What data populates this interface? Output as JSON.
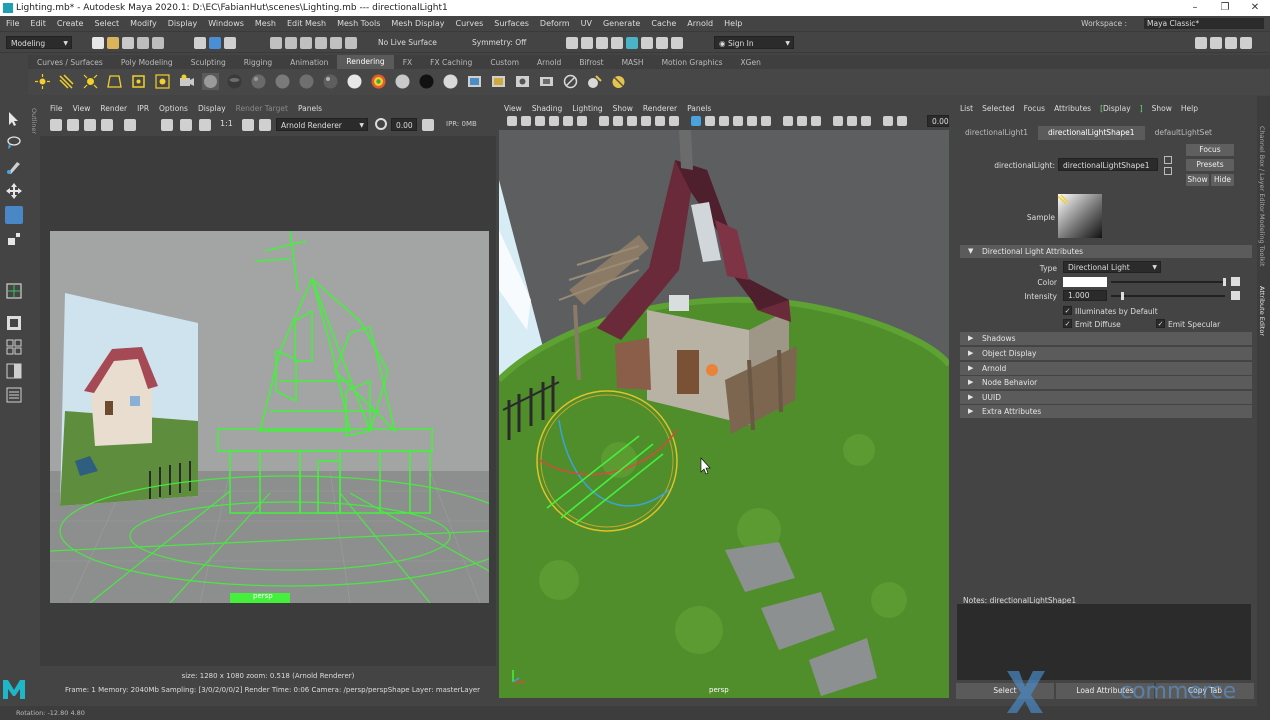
{
  "window": {
    "title": "Lighting.mb* - Autodesk Maya 2020.1: D:\\EC\\FabianHut\\scenes\\Lighting.mb   ---   directionalLight1",
    "controls": [
      "–",
      "❐",
      "✕"
    ]
  },
  "menubar": {
    "items": [
      "File",
      "Edit",
      "Create",
      "Select",
      "Modify",
      "Display",
      "Windows",
      "Mesh",
      "Edit Mesh",
      "Mesh Tools",
      "Mesh Display",
      "Curves",
      "Surfaces",
      "Deform",
      "UV",
      "Generate",
      "Cache",
      "Arnold",
      "Help"
    ],
    "workspace_label": "Workspace :",
    "workspace_value": "Maya Classic*"
  },
  "statusline": {
    "menuset": "Modeling",
    "live_surface": "No Live Surface",
    "symmetry": "Symmetry: Off",
    "sign_in": "Sign In"
  },
  "shelf": {
    "tabs": [
      "Curves / Surfaces",
      "Poly Modeling",
      "Sculpting",
      "Rigging",
      "Animation",
      "Rendering",
      "FX",
      "FX Caching",
      "Custom",
      "Arnold",
      "Bifrost",
      "MASH",
      "Motion Graphics",
      "XGen"
    ],
    "active_tab": "Rendering"
  },
  "render_view": {
    "menu": [
      "File",
      "View",
      "Render",
      "IPR",
      "Options",
      "Display",
      "Render Target",
      "Panels"
    ],
    "ratio": "1:1",
    "renderer": "Arnold Renderer",
    "exposure": "0.00",
    "ipr_mem": "IPR: 0MB",
    "camera_label": "persp",
    "status_line1": "size: 1280 x 1080  zoom: 0.518      (Arnold Renderer)",
    "status_line2": "Frame: 1      Memory: 2040Mb      Sampling: [3/0/2/0/0/2]   Render Time: 0:06      Camera: /persp/perspShape      Layer: masterLayer"
  },
  "viewport": {
    "menu": [
      "View",
      "Shading",
      "Lighting",
      "Show",
      "Renderer",
      "Panels"
    ],
    "value": "0.00",
    "camera_label": "persp"
  },
  "attribute_editor": {
    "menu": [
      "List",
      "Selected",
      "Focus",
      "Attributes",
      "Display",
      "Show",
      "Help"
    ],
    "tabs": [
      "directionalLight1",
      "directionalLightShape1",
      "defaultLightSet"
    ],
    "active_tab": "directionalLightShape1",
    "node_label": "directionalLight:",
    "node_value": "directionalLightShape1",
    "focus": "Focus",
    "presets": "Presets",
    "show": "Show",
    "hide": "Hide",
    "sample_label": "Sample",
    "section_open": "Directional Light Attributes",
    "type_label": "Type",
    "type_value": "Directional Light",
    "color_label": "Color",
    "intensity_label": "Intensity",
    "intensity_value": "1.000",
    "illuminates": "Illuminates by Default",
    "emit_diffuse": "Emit Diffuse",
    "emit_specular": "Emit Specular",
    "sections_closed": [
      "Shadows",
      "Object Display",
      "Arnold",
      "Node Behavior",
      "UUID",
      "Extra Attributes"
    ],
    "notes": "Notes:  directionalLightShape1",
    "bottom_buttons": [
      "Select",
      "Load Attributes",
      "Copy Tab"
    ]
  },
  "side_tabs": [
    "Channel Box / Layer Editor",
    "Modeling Toolkit",
    "Attribute Editor"
  ],
  "left_tab": "Outliner",
  "helpline": {
    "text": "Rotation:   -12.80        4.80"
  },
  "watermark": "commerce",
  "colors": {
    "accent_green": "#6ee36e",
    "wireframe": "#45f03d",
    "grass": "#4f8e2a",
    "roof": "#6a2a3a"
  }
}
